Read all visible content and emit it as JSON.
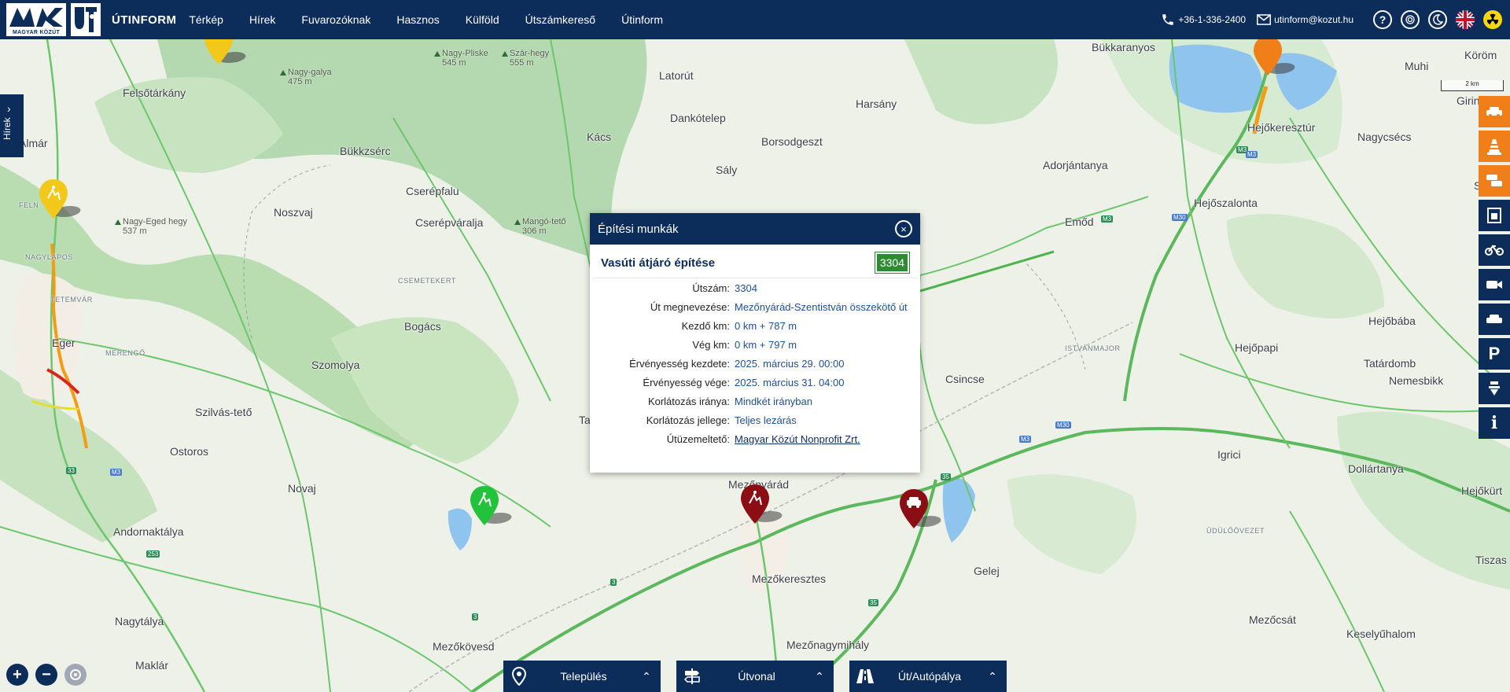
{
  "header": {
    "logo_caption": "MAGYAR KÖZÚT",
    "brand": "ÚTINFORM",
    "nav": [
      "Térkép",
      "Hírek",
      "Fuvarozóknak",
      "Hasznos",
      "Külföld",
      "Útszámkereső",
      "Útinform"
    ],
    "phone": "+36-1-336-2400",
    "email": "utinform@kozut.hu",
    "help_label": "?"
  },
  "side": {
    "news_tab": "Hírek",
    "scale": "2 km",
    "layers": [
      {
        "name": "car-accident-icon",
        "color": "#f07f1a"
      },
      {
        "name": "roadworks-cone-icon",
        "color": "#f07f1a"
      },
      {
        "name": "traffic-jam-icon",
        "color": "#f07f1a"
      },
      {
        "name": "border-crossing-icon",
        "color": "#0c2c5a"
      },
      {
        "name": "bicycle-icon",
        "color": "#0c2c5a"
      },
      {
        "name": "camera-icon",
        "color": "#0c2c5a"
      },
      {
        "name": "car-icon",
        "color": "#0c2c5a"
      },
      {
        "name": "parking-icon",
        "color": "#0c2c5a",
        "text": "P"
      },
      {
        "name": "rest-area-icon",
        "color": "#0c2c5a"
      },
      {
        "name": "info-icon",
        "color": "#0c2c5a",
        "text": "i"
      }
    ]
  },
  "popup": {
    "category": "Építési munkák",
    "title": "Vasúti átjáró építése",
    "road_number": "3304",
    "rows": [
      {
        "k": "Útszám:",
        "v": "3304"
      },
      {
        "k": "Út megnevezése:",
        "v": "Mezőnyárád-Szentistván összekötő út"
      },
      {
        "k": "Kezdő km:",
        "v": "0 km + 787 m"
      },
      {
        "k": "Vég km:",
        "v": "0 km + 797 m"
      },
      {
        "k": "Érvényesség kezdete:",
        "v": "2025. március 29. 00:00"
      },
      {
        "k": "Érvényesség vége:",
        "v": "2025. március 31. 04:00"
      },
      {
        "k": "Korlátozás iránya:",
        "v": "Mindkét irányban"
      },
      {
        "k": "Korlátozás jellege:",
        "v": "Teljes lezárás"
      },
      {
        "k": "Útüzemeltető:",
        "v": "Magyar Közút Nonprofit Zrt."
      }
    ]
  },
  "map": {
    "places": [
      {
        "t": "Felsőtárkány"
      },
      {
        "t": "Almár"
      },
      {
        "t": "Bükkzsérc"
      },
      {
        "t": "Noszvaj"
      },
      {
        "t": "Cserépfalu"
      },
      {
        "t": "Cserépváralja"
      },
      {
        "t": "Bogács"
      },
      {
        "t": "Szomolya"
      },
      {
        "t": "Eger"
      },
      {
        "t": "Szilvás-tető"
      },
      {
        "t": "Ostoros"
      },
      {
        "t": "Novaj"
      },
      {
        "t": "Andornaktálya"
      },
      {
        "t": "Nagytálya"
      },
      {
        "t": "Maklár"
      },
      {
        "t": "Mezőkövesd"
      },
      {
        "t": "Latorút"
      },
      {
        "t": "Dankótelep"
      },
      {
        "t": "Kács"
      },
      {
        "t": "Sály"
      },
      {
        "t": "Borsodgeszt"
      },
      {
        "t": "Harsány"
      },
      {
        "t": "Bükkaranyos"
      },
      {
        "t": "Muhi"
      },
      {
        "t": "Köröm"
      },
      {
        "t": "Hejőkeresztúr"
      },
      {
        "t": "Adorjántanya"
      },
      {
        "t": "Nagycsécs"
      },
      {
        "t": "Girincs"
      },
      {
        "t": "Sajós"
      },
      {
        "t": "Hejőszalonta"
      },
      {
        "t": "Emőd"
      },
      {
        "t": "Hejőbába"
      },
      {
        "t": "Hejőpapi"
      },
      {
        "t": "Tatárdomb"
      },
      {
        "t": "Nemesbikk"
      },
      {
        "t": "Csincse"
      },
      {
        "t": "Igrici"
      },
      {
        "t": "Dollártanya"
      },
      {
        "t": "Hejőkürt"
      },
      {
        "t": "Mezőnyárád"
      },
      {
        "t": "Mezőkeresztes"
      },
      {
        "t": "Gelej"
      },
      {
        "t": "Tiszas"
      },
      {
        "t": "Mezőcsát"
      },
      {
        "t": "Keselyűhalom"
      },
      {
        "t": "Mezőnagymihály"
      },
      {
        "t": "Ta"
      }
    ],
    "small_places": [
      {
        "t": "FELN"
      },
      {
        "t": "NAGYLAPOS"
      },
      {
        "t": "TETEMVÁR"
      },
      {
        "t": "MERENGŐ"
      },
      {
        "t": "CSEMETEKERT"
      },
      {
        "t": "ISTVÁNMAJOR"
      },
      {
        "t": "ÜDÜLŐÖVEZET"
      }
    ],
    "peaks": [
      {
        "name": "Nagy-galya",
        "h": "475 m"
      },
      {
        "name": "Nagy-Pliske",
        "h": "545 m"
      },
      {
        "name": "Szár-hegy",
        "h": "555 m"
      },
      {
        "name": "Nagy-Eged hegy",
        "h": "537 m"
      },
      {
        "name": "Mangó-tető",
        "h": "306 m"
      }
    ],
    "shields": [
      "M3",
      "M3",
      "M30",
      "M30",
      "M3",
      "M3",
      "253",
      "3",
      "3",
      "33",
      "35",
      "35",
      "M3"
    ]
  },
  "bottom_bars": [
    {
      "label": "Település"
    },
    {
      "label": "Útvonal"
    },
    {
      "label": "Út/Autópálya"
    }
  ],
  "colors": {
    "brand_navy": "#0c2c5a",
    "layer_orange": "#f07f1a",
    "road_green": "#2e8b34",
    "marker_dark_red": "#8b0e14",
    "marker_green": "#22c33a",
    "marker_yellow": "#f2c81a"
  }
}
